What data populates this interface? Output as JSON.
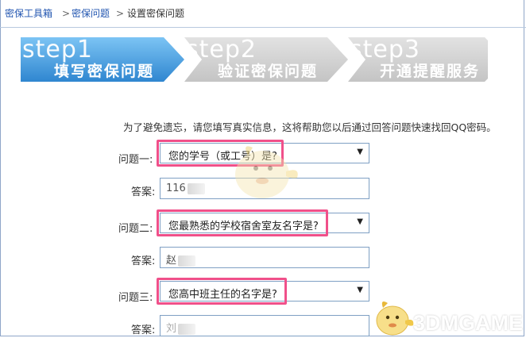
{
  "breadcrumb": {
    "item1": "密保工具箱",
    "sep": ">",
    "item2": "密保问题",
    "item3": "设置密保问题"
  },
  "steps": [
    {
      "num": "step1",
      "title": "填写密保问题",
      "state": "active"
    },
    {
      "num": "step2",
      "title": "验证密保问题",
      "state": "inactive"
    },
    {
      "num": "step3",
      "title": "开通提醒服务",
      "state": "inactive"
    }
  ],
  "intro": "为了避免遗忘，请您填写真实信息，这将帮助您以后通过回答问题快速找回QQ密码。",
  "form": {
    "q1_label": "问题一:",
    "q1_value": "您的学号（或工号）是?",
    "a1_label": "答案:",
    "a1_value": "116",
    "q2_label": "问题二:",
    "q2_value": "您最熟悉的学校宿舍室友名字是?",
    "a2_label": "答案:",
    "a2_value": "赵",
    "q3_label": "问题三:",
    "q3_value": "您高中班主任的名字是?",
    "a3_label": "答案:",
    "a3_value": "刘"
  },
  "watermark": "3DMGAME",
  "colors": {
    "active_step": "#4a9fe0",
    "inactive_step": "#c9c9c9",
    "highlight": "#f0508a",
    "link": "#2155b0",
    "input_border": "#7fa0c4"
  }
}
